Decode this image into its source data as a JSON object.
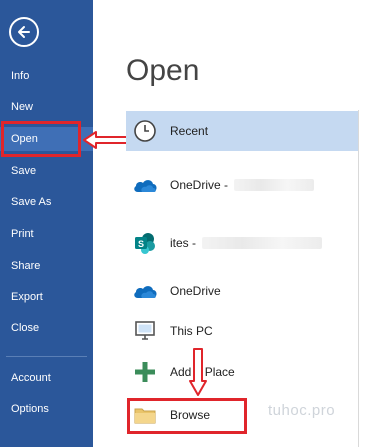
{
  "sidebar": {
    "back_icon": "back-arrow-icon",
    "items": [
      {
        "label": "Info"
      },
      {
        "label": "New"
      },
      {
        "label": "Open"
      },
      {
        "label": "Save"
      },
      {
        "label": "Save As"
      },
      {
        "label": "Print"
      },
      {
        "label": "Share"
      },
      {
        "label": "Export"
      },
      {
        "label": "Close"
      },
      {
        "label": "Account"
      },
      {
        "label": "Options"
      }
    ],
    "active": "Open",
    "background_color": "#2b579a"
  },
  "main": {
    "title": "Open",
    "locations": [
      {
        "label": "Recent",
        "icon": "clock-icon",
        "selected": true
      },
      {
        "label": "OneDrive -",
        "icon": "onedrive-cloud-icon",
        "selected": false
      },
      {
        "label": "ites -",
        "icon": "sharepoint-icon",
        "selected": false
      },
      {
        "label": "OneDrive",
        "icon": "onedrive-cloud-icon",
        "selected": false
      },
      {
        "label": "This PC",
        "icon": "computer-icon",
        "selected": false
      },
      {
        "label": "Add a Place",
        "icon": "plus-icon",
        "selected": false
      },
      {
        "label": "Browse",
        "icon": "folder-icon",
        "selected": false
      }
    ]
  },
  "watermark": "tuhoc.pro",
  "annotation_color": "#e0252b"
}
